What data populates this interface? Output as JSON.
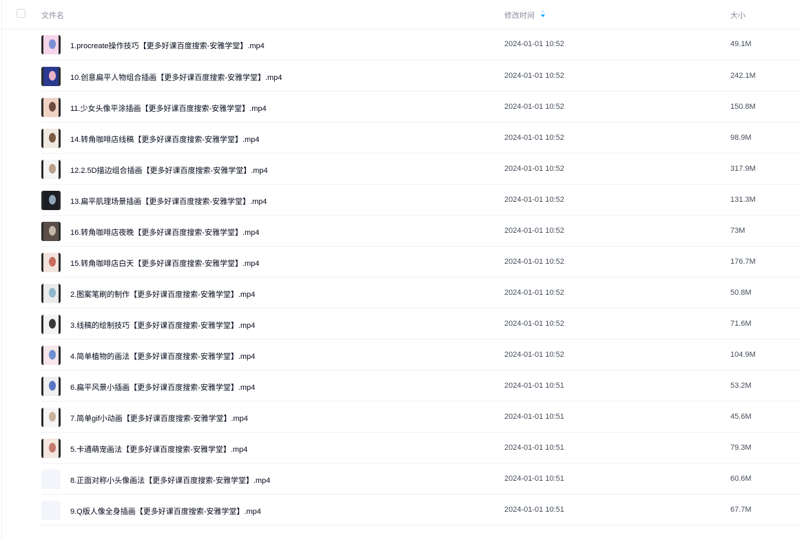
{
  "header": {
    "name_label": "文件名",
    "time_label": "修改时间",
    "size_label": "大小"
  },
  "colors": {
    "accent": "#06a7ff",
    "text": "#03081a",
    "muted": "#878c9c",
    "divider": "#eef0f3"
  },
  "files": [
    {
      "name": "1.procreate操作技巧【更多好课百度搜索-安雅学堂】.mp4",
      "time": "2024-01-01 10:52",
      "size": "49.1M",
      "thumb": "video-thumbnail-icon"
    },
    {
      "name": "10.创意扁平人物组合插画【更多好课百度搜索-安雅学堂】.mp4",
      "time": "2024-01-01 10:52",
      "size": "242.1M",
      "thumb": "video-thumbnail-icon"
    },
    {
      "name": "11.少女头像平涂插画【更多好课百度搜索-安雅学堂】.mp4",
      "time": "2024-01-01 10:52",
      "size": "150.8M",
      "thumb": "video-thumbnail-icon"
    },
    {
      "name": "14.转角咖啡店线稿【更多好课百度搜索-安雅学堂】.mp4",
      "time": "2024-01-01 10:52",
      "size": "98.9M",
      "thumb": "video-thumbnail-icon"
    },
    {
      "name": "12.2.5D描边组合插画【更多好课百度搜索-安雅学堂】.mp4",
      "time": "2024-01-01 10:52",
      "size": "317.9M",
      "thumb": "video-thumbnail-icon"
    },
    {
      "name": "13.扁平肌理场景插画【更多好课百度搜索-安雅学堂】.mp4",
      "time": "2024-01-01 10:52",
      "size": "131.3M",
      "thumb": "video-thumbnail-icon"
    },
    {
      "name": "16.转角咖啡店夜晚【更多好课百度搜索-安雅学堂】.mp4",
      "time": "2024-01-01 10:52",
      "size": "73M",
      "thumb": "video-thumbnail-icon"
    },
    {
      "name": "15.转角咖啡店白天【更多好课百度搜索-安雅学堂】.mp4",
      "time": "2024-01-01 10:52",
      "size": "176.7M",
      "thumb": "video-thumbnail-icon"
    },
    {
      "name": "2.图案笔刷的制作【更多好课百度搜索-安雅学堂】.mp4",
      "time": "2024-01-01 10:52",
      "size": "50.8M",
      "thumb": "video-thumbnail-icon"
    },
    {
      "name": "3.线稿的绘制技巧【更多好课百度搜索-安雅学堂】.mp4",
      "time": "2024-01-01 10:52",
      "size": "71.6M",
      "thumb": "video-thumbnail-icon"
    },
    {
      "name": "4.简单植物的画法【更多好课百度搜索-安雅学堂】.mp4",
      "time": "2024-01-01 10:52",
      "size": "104.9M",
      "thumb": "video-thumbnail-icon"
    },
    {
      "name": "6.扁平风景小插画【更多好课百度搜索-安雅学堂】.mp4",
      "time": "2024-01-01 10:51",
      "size": "53.2M",
      "thumb": "video-thumbnail-icon"
    },
    {
      "name": "7.简单gif小动画【更多好课百度搜索-安雅学堂】.mp4",
      "time": "2024-01-01 10:51",
      "size": "45.6M",
      "thumb": "video-thumbnail-icon"
    },
    {
      "name": "5.卡通萌宠画法【更多好课百度搜索-安雅学堂】.mp4",
      "time": "2024-01-01 10:51",
      "size": "79.3M",
      "thumb": "video-thumbnail-icon"
    },
    {
      "name": "8.正面对称小头像画法【更多好课百度搜索-安雅学堂】.mp4",
      "time": "2024-01-01 10:51",
      "size": "60.6M",
      "thumb": "video-file-icon"
    },
    {
      "name": "9.Q版人像全身插画【更多好课百度搜索-安雅学堂】.mp4",
      "time": "2024-01-01 10:51",
      "size": "67.7M",
      "thumb": "video-file-icon"
    }
  ]
}
